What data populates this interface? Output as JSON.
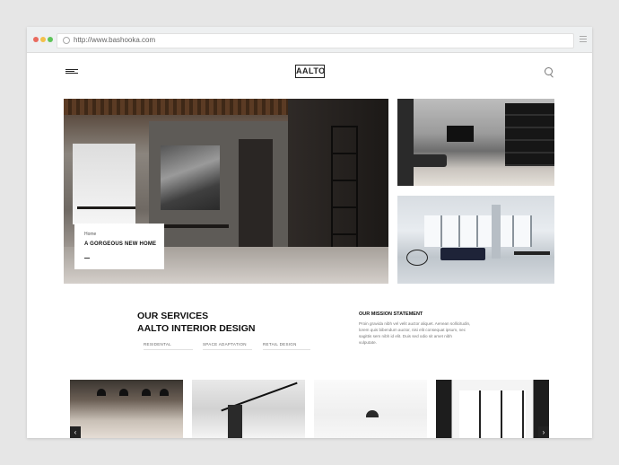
{
  "browser": {
    "url": "http://www.bashooka.com"
  },
  "header": {
    "logo": "AALTO"
  },
  "hero": {
    "breadcrumb": "Home",
    "title": "A GORGEOUS NEW HOME"
  },
  "services": {
    "heading_line1": "OUR SERVICES",
    "heading_line2": "AALTO INTERIOR DESIGN",
    "links": [
      "RESIDENTAL",
      "SPACE ADAPTATION",
      "RETAIL DESIGN"
    ]
  },
  "mission": {
    "heading": "OUR MISSION STATEMENT",
    "text": "Proin gravida nibh vel velit auctor aliquet. Aenean sollicitudin, lorem quis bibendum auctor, nisi elit consequat ipsum, nec sagittis sem nibh id elit. Duis sed odio sit amet nibh vulputate."
  },
  "carousel": {
    "prev": "‹",
    "next": "›"
  },
  "colors": {
    "text": "#111111",
    "muted": "#777777",
    "background": "#ffffff"
  }
}
